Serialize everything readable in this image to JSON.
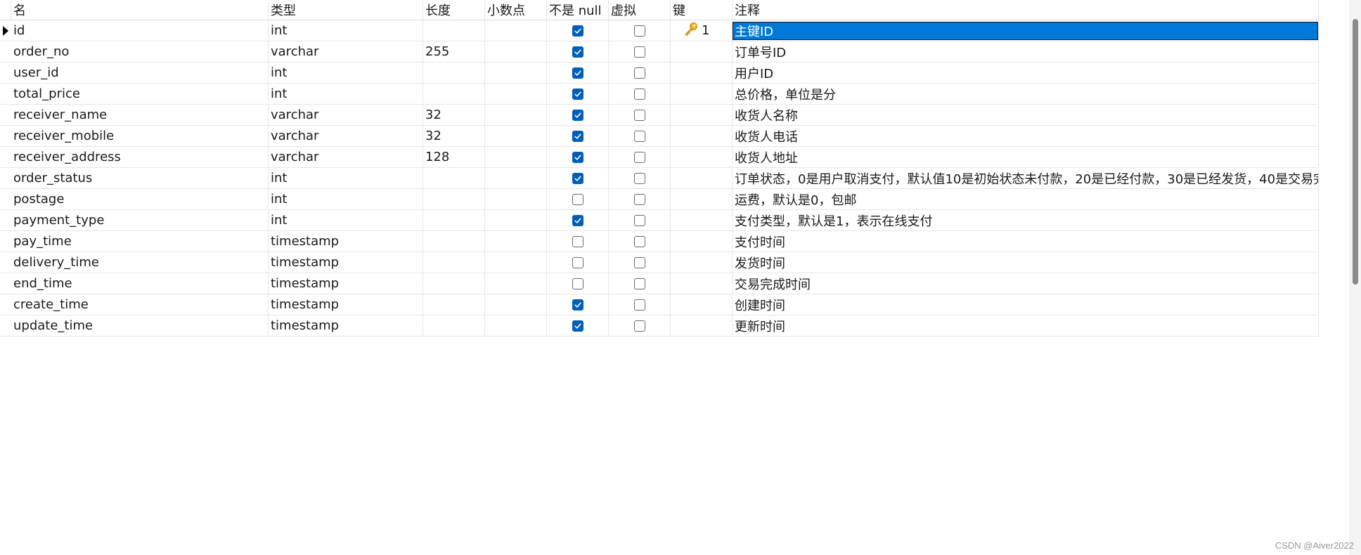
{
  "colors": {
    "accent": "#0078d7",
    "checkbox_checked": "#005fb8",
    "key_icon": "#e8a317"
  },
  "columns": {
    "name": "名",
    "type": "类型",
    "length": "长度",
    "decimal": "小数点",
    "not_null": "不是 null",
    "virtual": "虚拟",
    "key": "键",
    "comment": "注释"
  },
  "rows": [
    {
      "name": "id",
      "type": "int",
      "length": "",
      "decimal": "",
      "not_null": true,
      "virtual": false,
      "key": "1",
      "comment": "主键ID",
      "current": true,
      "selected": true
    },
    {
      "name": "order_no",
      "type": "varchar",
      "length": "255",
      "decimal": "",
      "not_null": true,
      "virtual": false,
      "key": "",
      "comment": "订单号ID"
    },
    {
      "name": "user_id",
      "type": "int",
      "length": "",
      "decimal": "",
      "not_null": true,
      "virtual": false,
      "key": "",
      "comment": "用户ID"
    },
    {
      "name": "total_price",
      "type": "int",
      "length": "",
      "decimal": "",
      "not_null": true,
      "virtual": false,
      "key": "",
      "comment": "总价格，单位是分"
    },
    {
      "name": "receiver_name",
      "type": "varchar",
      "length": "32",
      "decimal": "",
      "not_null": true,
      "virtual": false,
      "key": "",
      "comment": "收货人名称"
    },
    {
      "name": "receiver_mobile",
      "type": "varchar",
      "length": "32",
      "decimal": "",
      "not_null": true,
      "virtual": false,
      "key": "",
      "comment": "收货人电话"
    },
    {
      "name": "receiver_address",
      "type": "varchar",
      "length": "128",
      "decimal": "",
      "not_null": true,
      "virtual": false,
      "key": "",
      "comment": "收货人地址"
    },
    {
      "name": "order_status",
      "type": "int",
      "length": "",
      "decimal": "",
      "not_null": true,
      "virtual": false,
      "key": "",
      "comment": "订单状态，0是用户取消支付，默认值10是初始状态未付款，20是已经付款，30是已经发货，40是交易完"
    },
    {
      "name": "postage",
      "type": "int",
      "length": "",
      "decimal": "",
      "not_null": false,
      "virtual": false,
      "key": "",
      "comment": "运费，默认是0，包邮"
    },
    {
      "name": "payment_type",
      "type": "int",
      "length": "",
      "decimal": "",
      "not_null": true,
      "virtual": false,
      "key": "",
      "comment": "支付类型，默认是1，表示在线支付"
    },
    {
      "name": "pay_time",
      "type": "timestamp",
      "length": "",
      "decimal": "",
      "not_null": false,
      "virtual": false,
      "key": "",
      "comment": "支付时间"
    },
    {
      "name": "delivery_time",
      "type": "timestamp",
      "length": "",
      "decimal": "",
      "not_null": false,
      "virtual": false,
      "key": "",
      "comment": "发货时间"
    },
    {
      "name": "end_time",
      "type": "timestamp",
      "length": "",
      "decimal": "",
      "not_null": false,
      "virtual": false,
      "key": "",
      "comment": "交易完成时间"
    },
    {
      "name": "create_time",
      "type": "timestamp",
      "length": "",
      "decimal": "",
      "not_null": true,
      "virtual": false,
      "key": "",
      "comment": "创建时间"
    },
    {
      "name": "update_time",
      "type": "timestamp",
      "length": "",
      "decimal": "",
      "not_null": true,
      "virtual": false,
      "key": "",
      "comment": "更新时间"
    }
  ],
  "icons": {
    "row_marker": "current-row-arrow-icon",
    "key": "primary-key-icon",
    "checkbox": "checkmark-icon"
  },
  "watermark": "CSDN @Aiver2022"
}
